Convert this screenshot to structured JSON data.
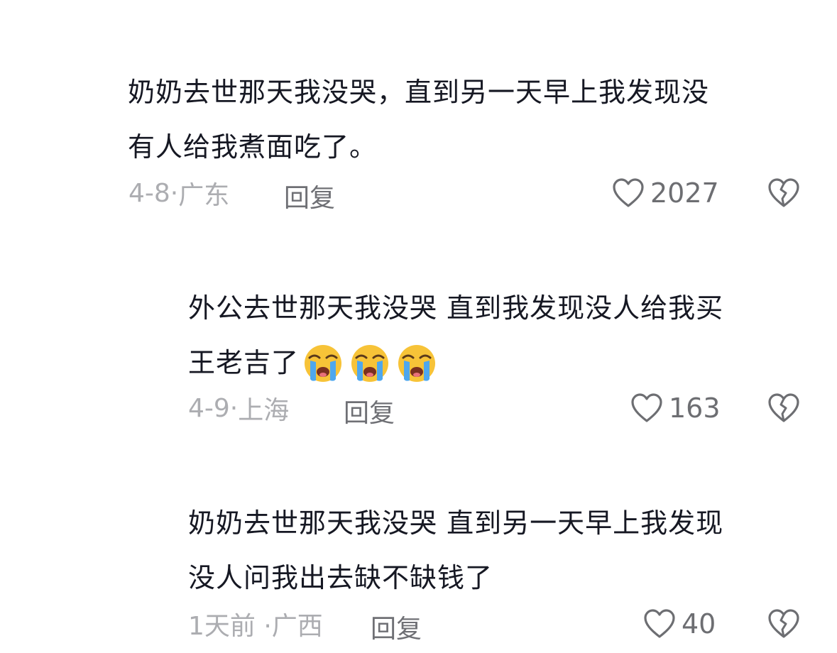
{
  "comments": [
    {
      "line1": "奶奶去世那天我没哭，直到另一天早上我发现没",
      "line2": "有人给我煮面吃了。",
      "date": "4-8·",
      "location": "广东",
      "reply_label": "回复",
      "likes": "2027"
    },
    {
      "line1": "外公去世那天我没哭 直到我发现没人给我买",
      "line2": "王老吉了",
      "emojis": [
        "crying-face-emoji",
        "crying-face-emoji",
        "crying-face-emoji"
      ],
      "date": "4-9·",
      "location": "上海",
      "reply_label": "回复",
      "likes": "163"
    },
    {
      "line1": "奶奶去世那天我没哭 直到另一天早上我发现",
      "line2": "没人问我出去缺不缺钱了",
      "date": "1天前 ·",
      "location": "广西",
      "reply_label": "回复",
      "likes": "40"
    }
  ],
  "icons": {
    "like": "heart-outline-icon",
    "dislike": "broken-heart-icon"
  },
  "colors": {
    "text": "#161823",
    "meta": "#acadb1",
    "reply": "#6f7075",
    "icon": "#6d6e72"
  }
}
